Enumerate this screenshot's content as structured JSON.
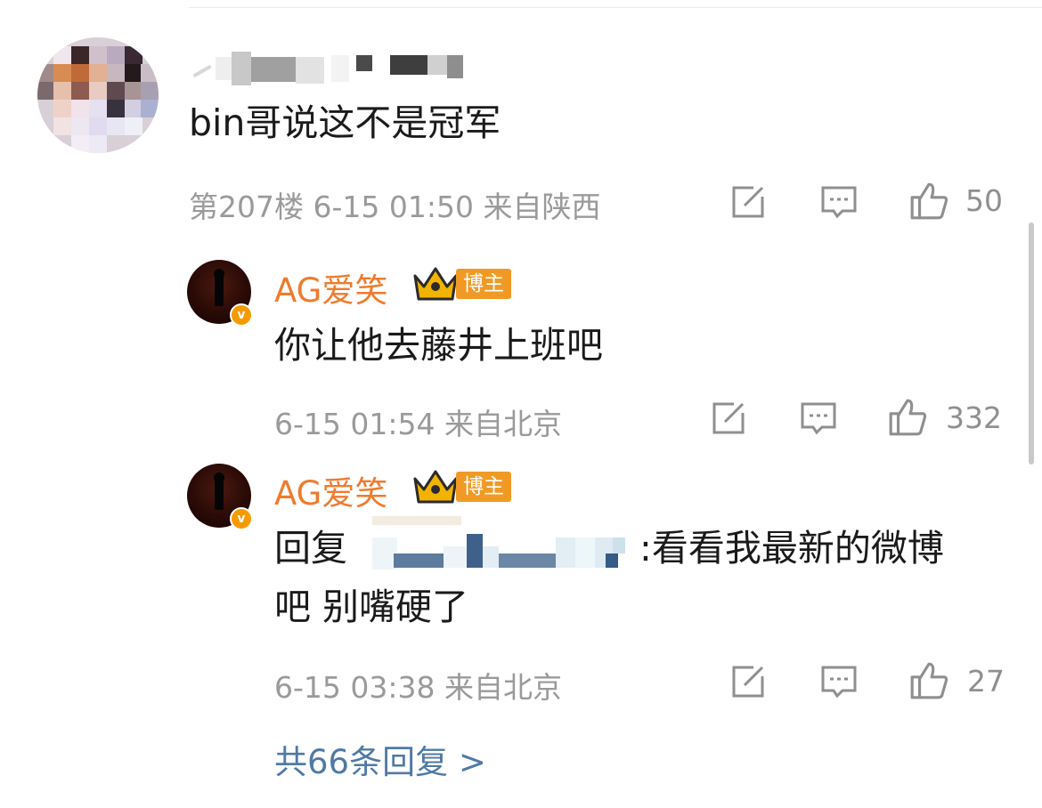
{
  "comment": {
    "text": "bin哥说这不是冠军",
    "meta": "第207楼 6-15 01:50 来自陕西",
    "likes": "50"
  },
  "replies": [
    {
      "author": "AG爱笑",
      "badge": "博主",
      "text": "你让他去藤井上班吧",
      "meta": "6-15 01:54 来自北京",
      "likes": "332"
    },
    {
      "author": "AG爱笑",
      "badge": "博主",
      "reply_prefix": "回复",
      "text_line1": ":看看我最新的微博",
      "text_line2": "吧 别嘴硬了",
      "meta": "6-15 03:38 来自北京",
      "likes": "27"
    }
  ],
  "more_replies": "共66条回复 >",
  "icons": [
    "edit-icon",
    "comment-icon",
    "like-icon",
    "crown-icon",
    "verified-icon"
  ],
  "colors": {
    "author": "#ee7b2e",
    "badge": "#f09a25",
    "link": "#4f7aa6",
    "meta": "#9a9a9a"
  }
}
